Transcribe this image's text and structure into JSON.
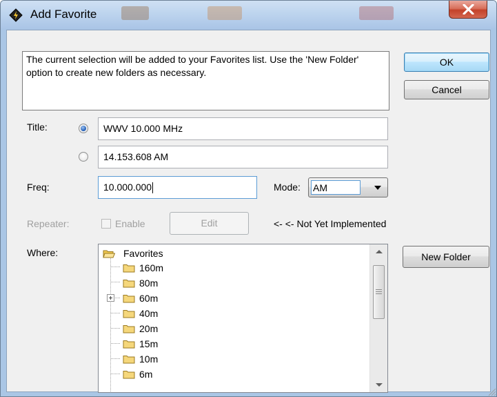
{
  "window": {
    "title": "Add Favorite",
    "title_icon": "app-diamond-icon",
    "close_icon": "close-icon"
  },
  "message": "The current selection will be added to your Favorites list. Use the 'New Folder' option to create new folders as necessary.",
  "buttons": {
    "ok": "OK",
    "cancel": "Cancel",
    "edit": "Edit",
    "new_folder": "New Folder"
  },
  "title_field": {
    "label": "Title:",
    "option1": "WWV 10.000 MHz",
    "option2": "14.153.608 AM",
    "selected": "option1"
  },
  "freq": {
    "label": "Freq:",
    "value": "10.000.000"
  },
  "mode": {
    "label": "Mode:",
    "value": "AM"
  },
  "repeater": {
    "label": "Repeater:",
    "enable_label": "Enable",
    "note": "<- <- Not Yet Implemented"
  },
  "where": {
    "label": "Where:",
    "root": "Favorites",
    "folders": [
      "160m",
      "80m",
      "60m",
      "40m",
      "20m",
      "15m",
      "10m",
      "6m"
    ],
    "expandable": [
      "60m"
    ]
  },
  "colors": {
    "titlebar": "#bdd4ee",
    "close": "#c3422a",
    "dialog_bg": "#f0f0f0",
    "default_button": "#bee6fd",
    "folder": "#f5d77b"
  }
}
